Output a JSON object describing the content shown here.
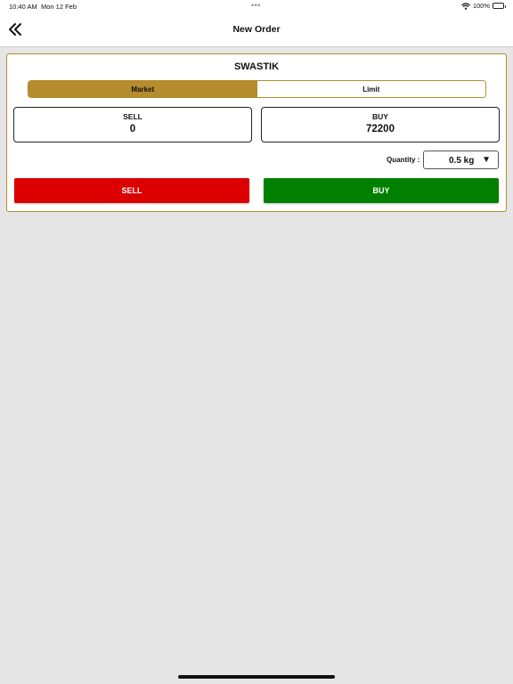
{
  "status_bar": {
    "time": "10:40 AM",
    "date": "Mon 12 Feb",
    "dots": "•••",
    "battery": "100%"
  },
  "nav": {
    "title": "New Order",
    "back_icon": "double-chevron-left-icon"
  },
  "order": {
    "symbol": "SWASTIK",
    "tabs": [
      {
        "label": "Market",
        "active": true
      },
      {
        "label": "Limit",
        "active": false
      }
    ],
    "sell": {
      "label": "SELL",
      "value": "0"
    },
    "buy": {
      "label": "BUY",
      "value": "72200"
    },
    "quantity": {
      "label": "Quantity :",
      "value": "0.5 kg",
      "arrow": "▼"
    },
    "sell_button": "SELL",
    "buy_button": "BUY"
  },
  "colors": {
    "accent_gold": "#b58c2e",
    "sell_red": "#dd0000",
    "buy_green": "#008000",
    "background": "#e6e6e6"
  }
}
